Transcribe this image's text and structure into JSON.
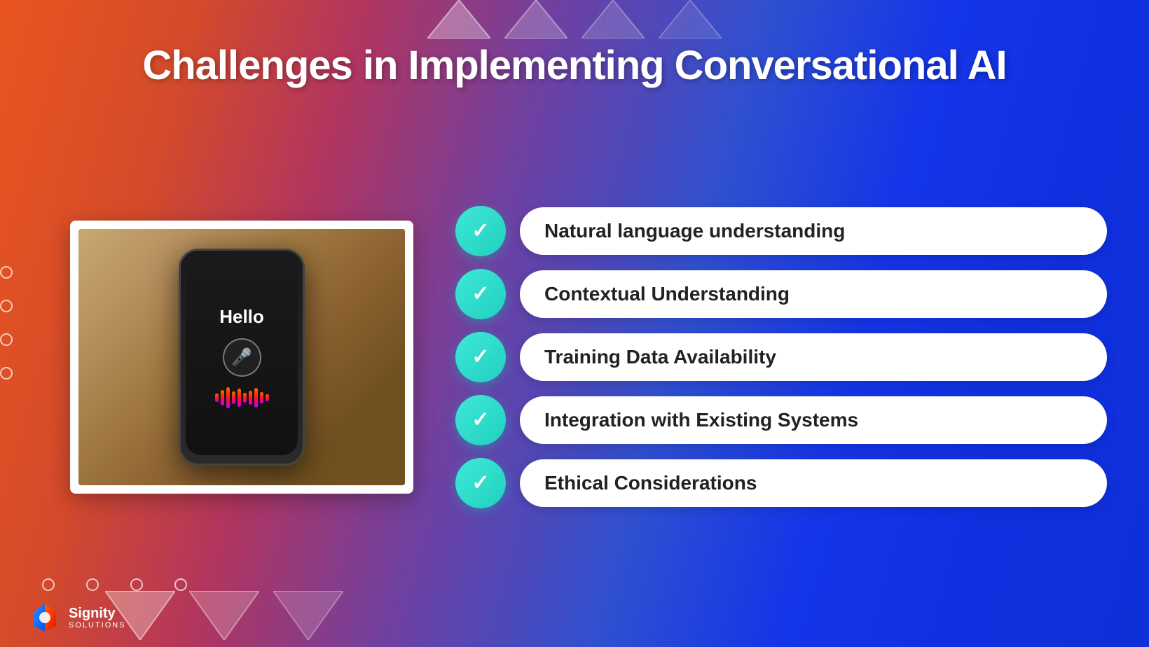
{
  "slide": {
    "title": "Challenges in Implementing Conversational AI",
    "checklist": [
      {
        "id": 1,
        "label": "Natural language understanding"
      },
      {
        "id": 2,
        "label": "Contextual Understanding"
      },
      {
        "id": 3,
        "label": "Training Data Availability"
      },
      {
        "id": 4,
        "label": "Integration with Existing Systems"
      },
      {
        "id": 5,
        "label": "Ethical Considerations"
      }
    ],
    "phone": {
      "hello_text": "Hello"
    },
    "logo": {
      "name": "Signity",
      "sub": "Solutions"
    },
    "colors": {
      "check_bubble": "#40e8d8",
      "bg_left": "#e85520",
      "bg_right": "#1030e0"
    }
  }
}
